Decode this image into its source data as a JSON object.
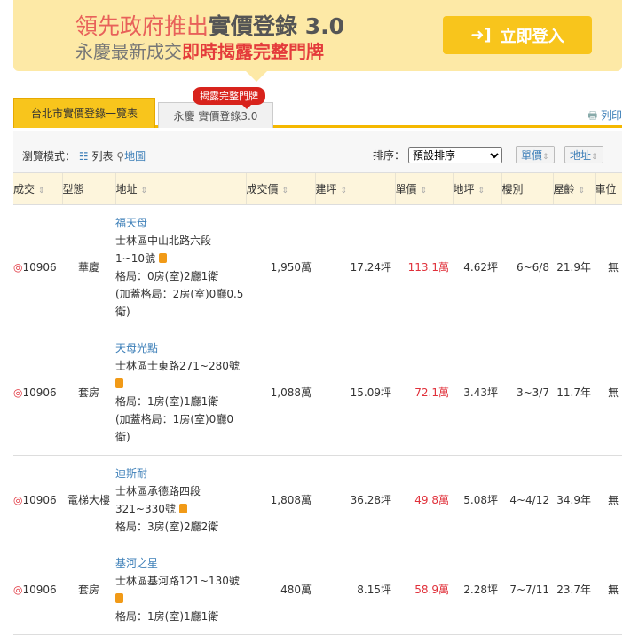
{
  "banner": {
    "line1_a": "領先政府推出",
    "line1_b": "實價登錄 3.0",
    "line2_a": "永慶最新成交",
    "line2_b": "即時揭露完整門牌",
    "login": "立即登入"
  },
  "tabs": {
    "tab1": "台北市實價登錄一覽表",
    "tab2": "永慶 實價登錄3.0",
    "badge": "揭露完整門牌",
    "print": "列印"
  },
  "toolbar": {
    "mode_label": "瀏覽模式：",
    "list": "列表",
    "map": "地圖",
    "sort_label": "排序：",
    "sort_value": "預設排序",
    "btn_price": "單價",
    "btn_addr": "地址"
  },
  "headers": [
    "成交",
    "型態",
    "地址",
    "成交價",
    "建坪",
    "單價",
    "地坪",
    "樓別",
    "屋齡",
    "車位"
  ],
  "rows": [
    {
      "date": "10906",
      "type": "華廈",
      "name": "福天母",
      "addr1": "士林區中山北路六段",
      "addr2": "1~10號",
      "layout": "格局：0房(室)2廳1衛",
      "extra": "(加蓋格局：2房(室)0廳0.5衛)",
      "price": "1,950萬",
      "area": "17.24坪",
      "unit": "113.1萬",
      "land": "4.62坪",
      "floor": "6~6/8",
      "age": "21.9年",
      "park": "無"
    },
    {
      "date": "10906",
      "type": "套房",
      "name": "天母光點",
      "addr1": "士林區士東路271~280號",
      "addr2": "",
      "layout": "格局：1房(室)1廳1衛",
      "extra": "(加蓋格局：1房(室)0廳0衛)",
      "price": "1,088萬",
      "area": "15.09坪",
      "unit": "72.1萬",
      "land": "3.43坪",
      "floor": "3~3/7",
      "age": "11.7年",
      "park": "無"
    },
    {
      "date": "10906",
      "type": "電梯大樓",
      "name": "迪斯耐",
      "addr1": "士林區承德路四段",
      "addr2": "321~330號",
      "layout": "格局：3房(室)2廳2衛",
      "extra": "",
      "price": "1,808萬",
      "area": "36.28坪",
      "unit": "49.8萬",
      "land": "5.08坪",
      "floor": "4~4/12",
      "age": "34.9年",
      "park": "無"
    },
    {
      "date": "10906",
      "type": "套房",
      "name": "基河之星",
      "addr1": "士林區基河路121~130號",
      "addr2": "",
      "layout": "格局：1房(室)1廳1衛",
      "extra": "",
      "price": "480萬",
      "area": "8.15坪",
      "unit": "58.9萬",
      "land": "2.28坪",
      "floor": "7~7/11",
      "age": "23.7年",
      "park": "無"
    }
  ]
}
